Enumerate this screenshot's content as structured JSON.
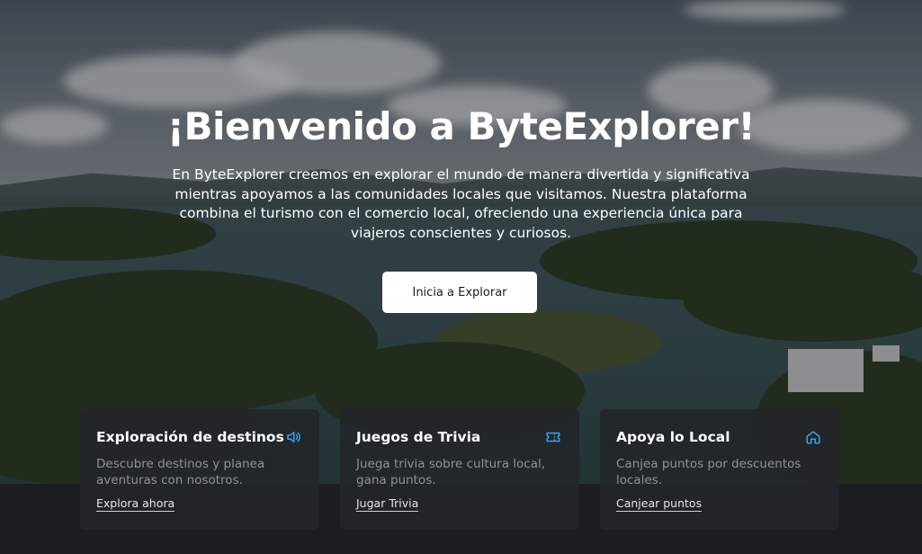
{
  "hero": {
    "title": "¡Bienvenido a ByteExplorer!",
    "description": "En ByteExplorer creemos en explorar el mundo de manera divertida y significativa mientras apoyamos a las comunidades locales que visitamos. Nuestra plataforma combina el turismo con el comercio local, ofreciendo una experiencia única para viajeros conscientes y curiosos.",
    "cta_label": "Inicia a Explorar"
  },
  "cards": [
    {
      "title": "Exploración de destinos",
      "icon": "speaker-icon",
      "description": "Descubre destinos y planea aventuras con nosotros.",
      "link": "Explora ahora"
    },
    {
      "title": "Juegos de Trivia",
      "icon": "ticket-icon",
      "description": "Juega trivia sobre cultura local, gana puntos.",
      "link": "Jugar Trivia"
    },
    {
      "title": "Apoya lo Local",
      "icon": "home-icon",
      "description": "Canjea puntos por descuentos locales.",
      "link": "Canjear puntos"
    }
  ],
  "colors": {
    "accent_icon": "#3aa0e8",
    "card_bg": "#22262a",
    "page_bg": "#1a1e21",
    "cta_bg": "#ffffff"
  }
}
